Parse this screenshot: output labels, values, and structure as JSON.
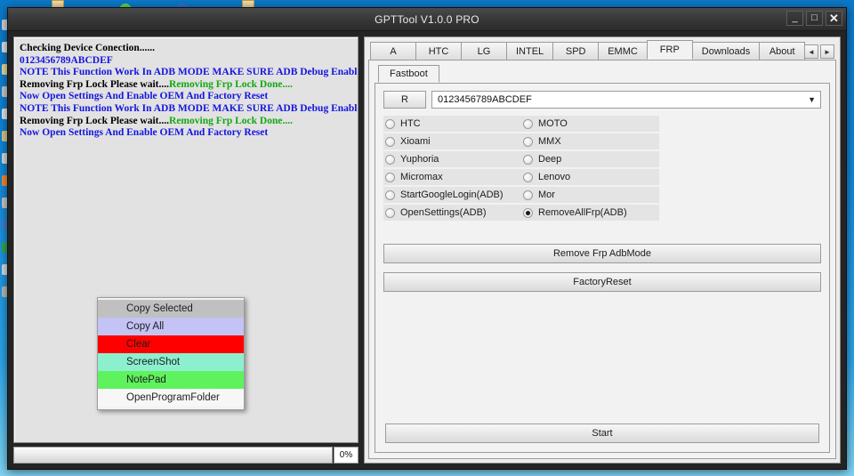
{
  "desktop": {
    "background_color": "#1186d8"
  },
  "window": {
    "title": "GPTTool V1.0.0 PRO",
    "controls": {
      "minimize": "_",
      "maximize": "□",
      "close": "✕"
    }
  },
  "log": {
    "lines": [
      [
        {
          "text": "Checking Device Conection......",
          "color": "black"
        }
      ],
      [
        {
          "text": "0123456789ABCDEF",
          "color": "blue"
        }
      ],
      [
        {
          "text": "NOTE This Function Work In ADB MODE MAKE SURE ADB Debug Enabled",
          "color": "blue"
        }
      ],
      [
        {
          "text": "Removing Frp Lock Please wait....",
          "color": "black"
        },
        {
          "text": "Removing Frp Lock Done....",
          "color": "green"
        }
      ],
      [
        {
          "text": "Now Open Settings And Enable OEM And Factory Reset",
          "color": "blue"
        }
      ],
      [
        {
          "text": "NOTE This Function Work In ADB MODE MAKE SURE ADB Debug Enabled",
          "color": "blue"
        }
      ],
      [
        {
          "text": "Removing Frp Lock Please wait....",
          "color": "black"
        },
        {
          "text": "Removing Frp Lock Done....",
          "color": "green"
        }
      ],
      [
        {
          "text": "Now Open Settings And Enable OEM And Factory Reset",
          "color": "blue"
        }
      ]
    ],
    "colors": {
      "black": "#000000",
      "blue": "#1515e0",
      "green": "#13a813"
    }
  },
  "progress": {
    "value": 0,
    "label": "0%"
  },
  "context_menu": {
    "items": [
      {
        "label": "Copy Selected",
        "bg": "#c0c0c0"
      },
      {
        "label": "Copy All",
        "bg": "#c3c3f5"
      },
      {
        "label": "Clear",
        "bg": "#ff0000"
      },
      {
        "label": "ScreenShot",
        "bg": "#8cf0cf"
      },
      {
        "label": "NotePad",
        "bg": "#5ef25e"
      },
      {
        "label": "OpenProgramFolder",
        "bg": "#f7f7f7"
      }
    ]
  },
  "tabs": {
    "items": [
      {
        "label": "A",
        "active": false
      },
      {
        "label": "HTC",
        "active": false
      },
      {
        "label": "LG",
        "active": false
      },
      {
        "label": "INTEL",
        "active": false
      },
      {
        "label": "SPD",
        "active": false
      },
      {
        "label": "EMMC",
        "active": false
      },
      {
        "label": "FRP",
        "active": true
      },
      {
        "label": "Downloads",
        "active": false
      },
      {
        "label": "About",
        "active": false
      }
    ],
    "scroll_left": "◄",
    "scroll_right": "►"
  },
  "frp_panel": {
    "subtab": "Fastboot",
    "read_button": "R",
    "serial_value": "0123456789ABCDEF",
    "combo_arrow": "▼",
    "options": [
      {
        "label": "HTC",
        "checked": false
      },
      {
        "label": "MOTO",
        "checked": false
      },
      {
        "label": "Xioami",
        "checked": false
      },
      {
        "label": "MMX",
        "checked": false
      },
      {
        "label": "Yuphoria",
        "checked": false
      },
      {
        "label": "Deep",
        "checked": false
      },
      {
        "label": "Micromax",
        "checked": false
      },
      {
        "label": "Lenovo",
        "checked": false
      },
      {
        "label": "StartGoogleLogin(ADB)",
        "checked": false
      },
      {
        "label": "Mor",
        "checked": false
      },
      {
        "label": "OpenSettings(ADB)",
        "checked": false
      },
      {
        "label": "RemoveAllFrp(ADB)",
        "checked": true
      }
    ],
    "remove_frp_button": "Remove Frp AdbMode",
    "factory_reset_button": "FactoryReset",
    "start_button": "Start"
  }
}
